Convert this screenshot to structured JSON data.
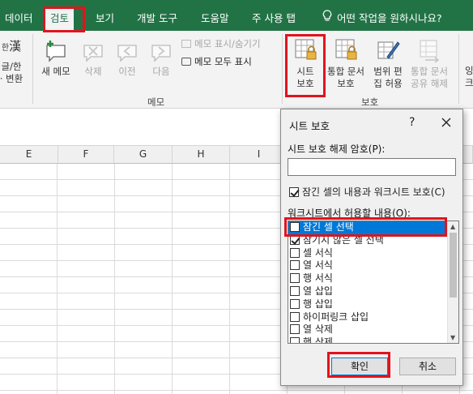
{
  "tabs": {
    "data": "데이터",
    "review": "검토",
    "view": "보기",
    "developer": "개발 도구",
    "help": "도움말",
    "main_tab": "주 사용 탭",
    "tell_me": "어떤 작업을 원하시나요?"
  },
  "ribbon": {
    "hanja_top": "한",
    "hanja_char": "漢",
    "hanja_label_1": "글/한",
    "hanja_label_2": "· 변환",
    "new_comment": "새 메모",
    "delete": "삭제",
    "previous": "이전",
    "next": "다음",
    "show_hide_comment": "메모 표시/숨기기",
    "show_all_comments": "메모 모두 표시",
    "comments_group": "메모",
    "protect_sheet_1": "시트",
    "protect_sheet_2": "보호",
    "protect_workbook_1": "통합 문서",
    "protect_workbook_2": "보호",
    "allow_edit_1": "범위 편",
    "allow_edit_2": "집 허용",
    "unshare_1": "통합 문서",
    "unshare_2": "공유 해제",
    "protect_group": "보호",
    "cut_label_1": "잉",
    "cut_label_2": "크"
  },
  "columns": [
    "E",
    "F",
    "G",
    "H",
    "I"
  ],
  "dialog": {
    "title": "시트 보호",
    "help": "?",
    "password_label": "시트 보호 해제 암호(P):",
    "password_value": "",
    "protect_contents": "잠긴 셀의 내용과 워크시트 보호(C)",
    "allow_label": "워크시트에서 허용할 내용(O):",
    "permissions": [
      {
        "label": "잠긴 셀 선택",
        "checked": false,
        "selected": true
      },
      {
        "label": "잠기지 않은 셀 선택",
        "checked": true,
        "selected": false
      },
      {
        "label": "셀 서식",
        "checked": false,
        "selected": false
      },
      {
        "label": "열 서식",
        "checked": false,
        "selected": false
      },
      {
        "label": "행 서식",
        "checked": false,
        "selected": false
      },
      {
        "label": "열 삽입",
        "checked": false,
        "selected": false
      },
      {
        "label": "행 삽입",
        "checked": false,
        "selected": false
      },
      {
        "label": "하이퍼링크 삽입",
        "checked": false,
        "selected": false
      },
      {
        "label": "열 삭제",
        "checked": false,
        "selected": false
      },
      {
        "label": "행 삭제",
        "checked": false,
        "selected": false
      }
    ],
    "ok": "확인",
    "cancel": "취소"
  },
  "colors": {
    "excel_green": "#217346",
    "annotation_red": "#e0141e",
    "selection_blue": "#0078d7"
  }
}
